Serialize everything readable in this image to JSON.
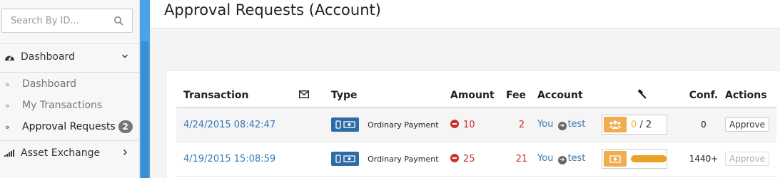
{
  "sidebar": {
    "search_placeholder": "Search By ID...",
    "dashboard_label": "Dashboard",
    "sub_items": [
      {
        "label": "Dashboard"
      },
      {
        "label": "My Transactions"
      },
      {
        "label": "Approval Requests",
        "badge": "2"
      }
    ],
    "asset_exchange_label": "Asset Exchange"
  },
  "page": {
    "title": "Approval Requests (Account)"
  },
  "table": {
    "headers": {
      "transaction": "Transaction",
      "type": "Type",
      "amount": "Amount",
      "fee": "Fee",
      "account": "Account",
      "conf": "Conf.",
      "actions": "Actions"
    },
    "rows": [
      {
        "date": "4/24/2015 08:42:47",
        "type": "Ordinary Payment",
        "amount": "10",
        "fee": "2",
        "from": "You",
        "to": "test",
        "phasing_have": "0",
        "phasing_need": " / 2",
        "phasing_progress": 1.0,
        "conf": "0",
        "action": "Approve"
      },
      {
        "date": "4/19/2015 15:08:59",
        "type": "Ordinary Payment",
        "amount": "25",
        "fee": "21",
        "from": "You",
        "to": "test",
        "phasing_progress": 1.0,
        "conf": "1440+",
        "action": "Approve"
      }
    ]
  },
  "colors": {
    "accent": "#337ab7",
    "negative": "#c9302c",
    "warning": "#f0ad4e",
    "scrollbar": "#4aa3e6"
  }
}
